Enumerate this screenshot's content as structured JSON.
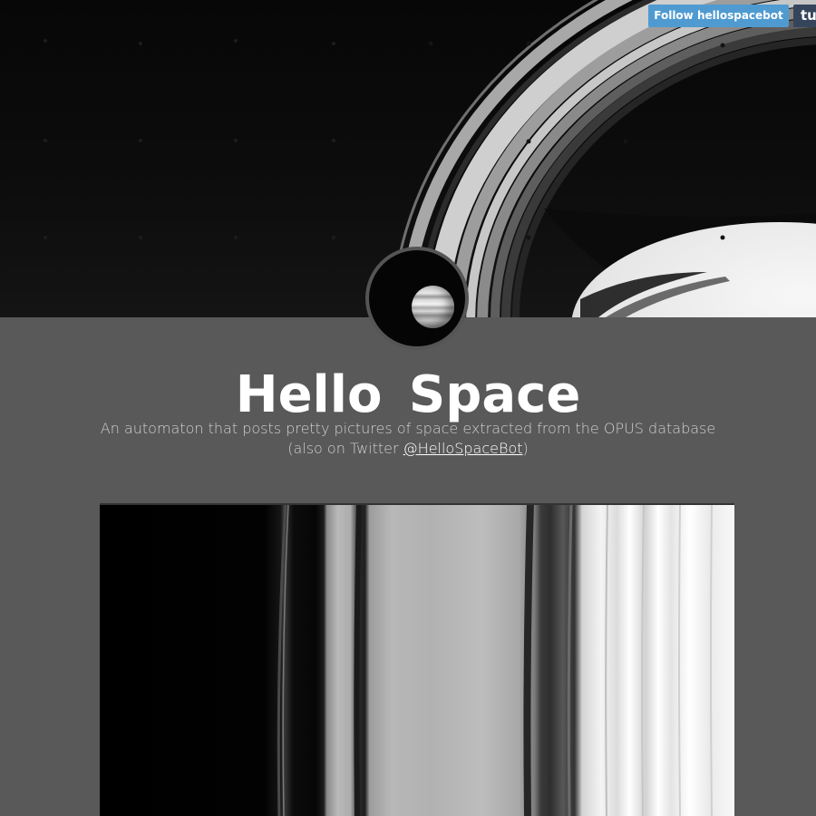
{
  "tumblr_controls": {
    "follow_label": "Follow hellospacebot",
    "logo_label": "tu"
  },
  "blog": {
    "title": "Hello Space",
    "description_line1": "An automaton that posts pretty pictures of space extracted from the OPUS database",
    "description_prefix": "(also on Twitter ",
    "twitter_handle": "@HelloSpaceBot",
    "description_suffix": ")"
  },
  "icons": {
    "avatar": "jupiter-avatar-icon",
    "banner": "saturn-rings-image",
    "post": "saturn-rings-closeup-image"
  },
  "colors": {
    "page_background": "#595959",
    "follow_button": "#4f9bd1",
    "tumblr_logo": "#35465c",
    "title_text": "#ffffff"
  }
}
